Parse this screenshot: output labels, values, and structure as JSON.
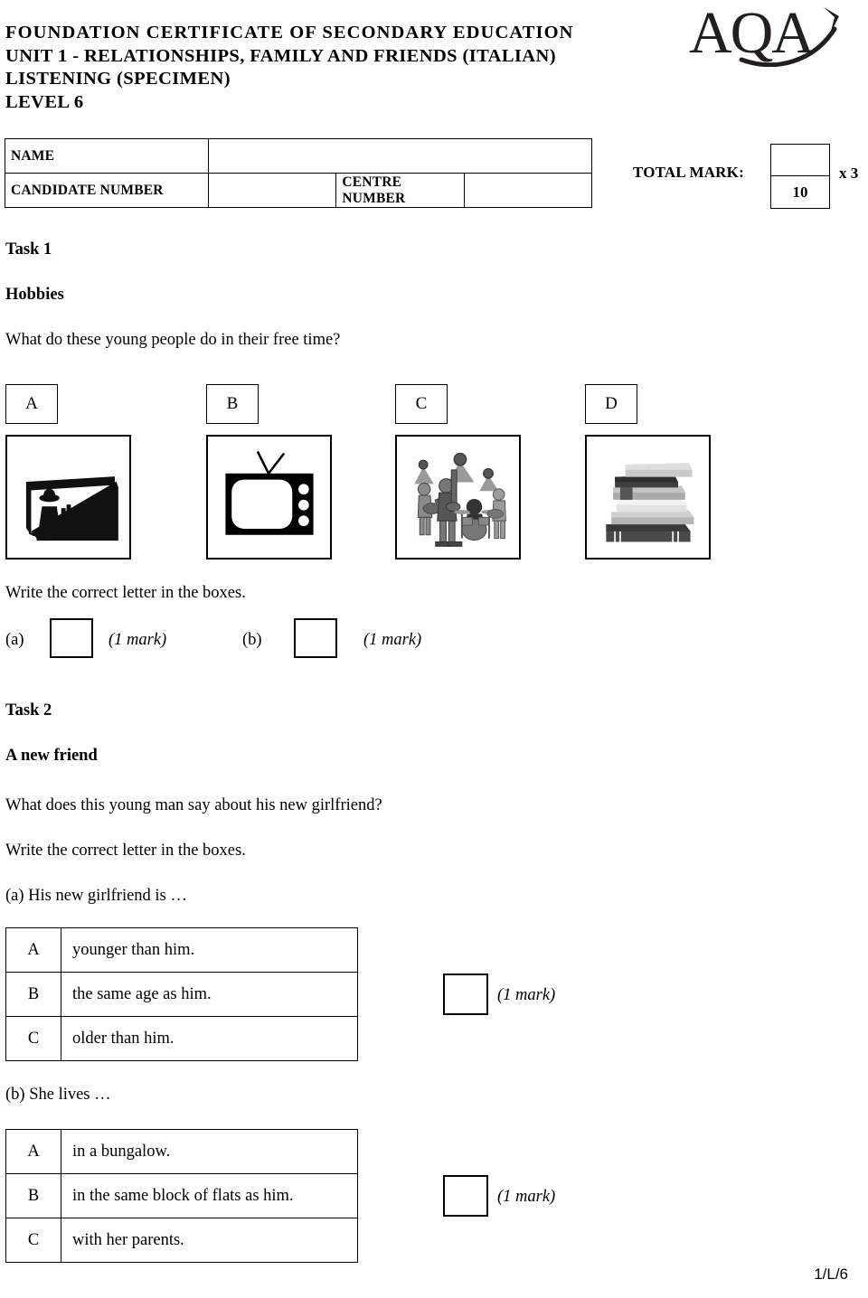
{
  "header": {
    "title_lines": [
      "FOUNDATION  CERTIFICATE  OF  SECONDARY  EDUCATION",
      "UNIT 1 -  RELATIONSHIPS, FAMILY AND FRIENDS (ITALIAN)",
      "LISTENING  (SPECIMEN)",
      "LEVEL  6"
    ],
    "logo_text": "AQA"
  },
  "candidate_table": {
    "name_label": "NAME",
    "name_value": "",
    "candidate_number_label": "CANDIDATE NUMBER",
    "candidate_number_value": "",
    "centre_number_label": "CENTRE NUMBER",
    "centre_number_value": ""
  },
  "total_mark": {
    "label": "TOTAL MARK:",
    "entered_value": "",
    "max_value": "10",
    "multiplier": "x 3"
  },
  "task1": {
    "task_label": "Task 1",
    "topic": "Hobbies",
    "question": "What do these young people do in their free time?",
    "instruction": "Write the correct letter in the boxes.",
    "options": [
      {
        "letter": "A",
        "picture": "cinema-screen-picture"
      },
      {
        "letter": "B",
        "picture": "television-picture"
      },
      {
        "letter": "C",
        "picture": "rock-band-picture"
      },
      {
        "letter": "D",
        "picture": "book-stack-picture"
      }
    ],
    "answers": [
      {
        "label": "(a)",
        "value": "",
        "mark": "(1 mark)"
      },
      {
        "label": "(b)",
        "value": "",
        "mark": "(1 mark)"
      }
    ]
  },
  "task2": {
    "task_label": "Task 2",
    "topic": "A new friend",
    "question": "What does this young man say about his new girlfriend?",
    "instruction": "Write the correct letter in the boxes.",
    "parts": [
      {
        "stem": "(a)  His new girlfriend is …",
        "options": [
          {
            "letter": "A",
            "text": "younger than him."
          },
          {
            "letter": "B",
            "text": "the same age as him."
          },
          {
            "letter": "C",
            "text": "older than him."
          }
        ],
        "answer_value": "",
        "mark": "(1 mark)"
      },
      {
        "stem": "(b)  She lives …",
        "options": [
          {
            "letter": "A",
            "text": "in a bungalow."
          },
          {
            "letter": "B",
            "text": "in the same block of flats as him."
          },
          {
            "letter": "C",
            "text": "with her parents."
          }
        ],
        "answer_value": "",
        "mark": "(1 mark)"
      }
    ]
  },
  "footer": {
    "page_code": "1/L/6"
  }
}
